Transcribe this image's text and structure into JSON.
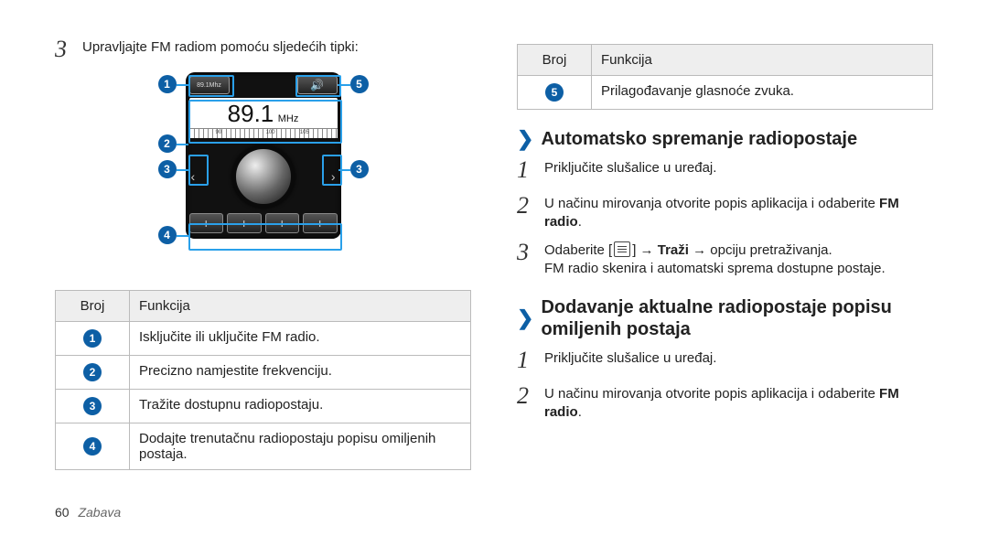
{
  "left": {
    "step3": "Upravljajte FM radiom pomoću sljedećih tipki:",
    "radio": {
      "btn_label": "89.1Mhz",
      "freq": "89.1",
      "unit": "MHz",
      "ruler_90": "90",
      "ruler_100": "100",
      "ruler_105": "105"
    },
    "table": {
      "h1": "Broj",
      "h2": "Funkcija",
      "r1": "Isključite ili uključite FM radio.",
      "r2": "Precizno namjestite frekvenciju.",
      "r3": "Tražite dostupnu radiopostaju.",
      "r4": "Dodajte trenutačnu radiopostaju popisu omiljenih postaja."
    }
  },
  "right": {
    "table": {
      "h1": "Broj",
      "h2": "Funkcija",
      "r5": "Prilagođavanje glasnoće zvuka."
    },
    "secA": {
      "title": "Automatsko spremanje radiopostaje",
      "s1": "Priključite slušalice u uređaj.",
      "s2a": "U načinu mirovanja otvorite popis aplikacija i odaberite",
      "s2b": "FM radio",
      "s3a": "Odaberite [",
      "s3b": "] → ",
      "s3c": "Traži",
      "s3d": " → opciju pretraživanja.",
      "s3note": "FM radio skenira i automatski sprema dostupne postaje."
    },
    "secB": {
      "title": "Dodavanje aktualne radiopostaje popisu omiljenih postaja",
      "s1": "Priključite slušalice u uređaj.",
      "s2a": "U načinu mirovanja otvorite popis aplikacija i odaberite",
      "s2b": "FM radio"
    }
  },
  "footer": {
    "page": "60",
    "section": "Zabava"
  }
}
